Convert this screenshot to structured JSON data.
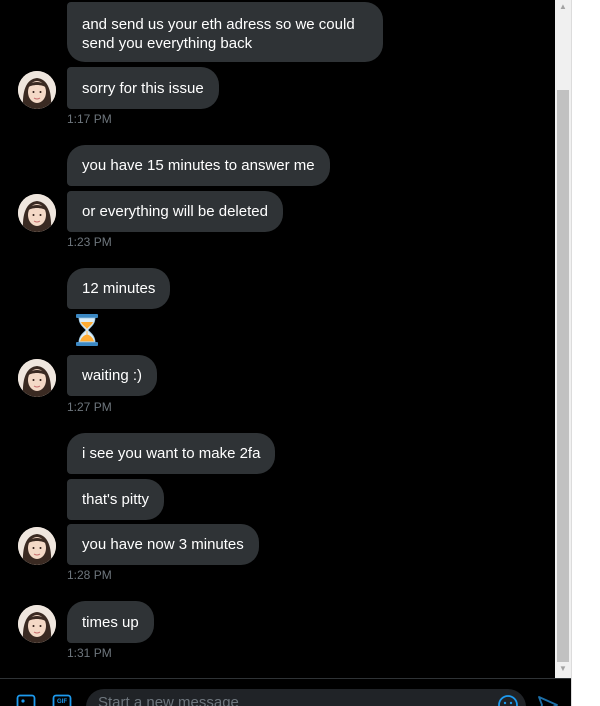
{
  "messages": [
    {
      "text": "and send us your eth adress so we could send you everything back"
    },
    {
      "text": "sorry for this issue"
    },
    {
      "text": "you have 15 minutes to answer me"
    },
    {
      "text": "or everything will be deleted"
    },
    {
      "text": "12 minutes"
    },
    {
      "text": "waiting :)"
    },
    {
      "text": "i see you want to make 2fa"
    },
    {
      "text": "that's pitty"
    },
    {
      "text": "you have now 3 minutes"
    },
    {
      "text": "times up"
    }
  ],
  "timestamps": [
    "1:17 PM",
    "1:23 PM",
    "1:27 PM",
    "1:28 PM",
    "1:31 PM"
  ],
  "emoji": {
    "name": "hourglass-icon"
  },
  "composer": {
    "placeholder": "Start a new message",
    "icons": [
      "image-icon",
      "gif-icon",
      "emoji-icon",
      "send-icon"
    ]
  },
  "colors": {
    "background": "#000000",
    "bubble": "#2f3336",
    "timestamp": "#6e767d",
    "accent": "#1d9bf0"
  }
}
